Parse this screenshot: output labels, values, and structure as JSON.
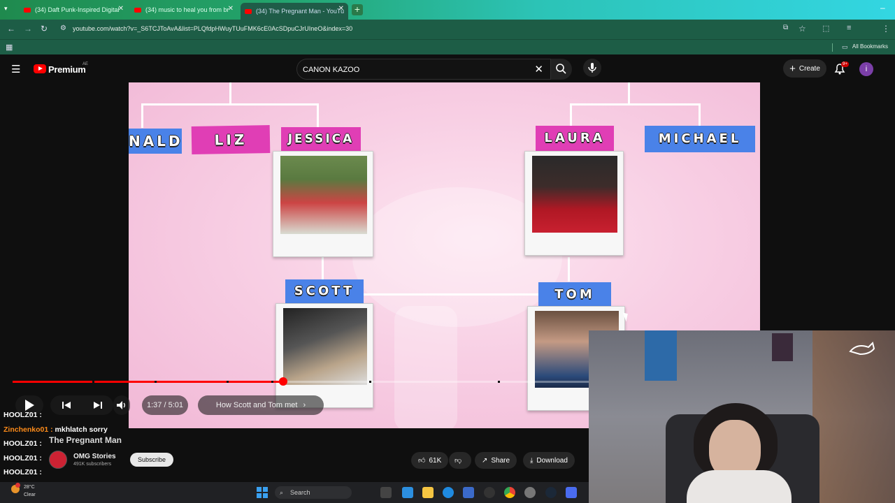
{
  "browser": {
    "tabs": [
      {
        "title": "(34) Daft Punk-Inspired Digital",
        "active": false
      },
      {
        "title": "(34) music to heal you from br",
        "active": false
      },
      {
        "title": "(34) The Pregnant Man - YouTu",
        "active": true
      }
    ],
    "url": "youtube.com/watch?v=_S6TCJToAvA&list=PLQfdpHWuyTUuFMK6cE0AcSDpuCJrUIneO&index=30",
    "bookmarks_label": "All Bookmarks"
  },
  "youtube": {
    "brand": "Premium",
    "country_code": "AE",
    "search_value": "CANON KAZOO",
    "create_label": "Create",
    "notif_badge": "9+",
    "avatar_letter": "i"
  },
  "video_frame": {
    "names": {
      "n1": "NALD",
      "n2": "LIZ",
      "n3": "JESSICA",
      "n4": "LAURA",
      "n5": "MICHAEL",
      "n6": "SCOTT",
      "n7": "TOM"
    }
  },
  "player": {
    "progress": 0.47,
    "time": "1:37 / 5:01",
    "chapter": "How Scott and Tom met"
  },
  "chat": [
    {
      "user": "HOOLZ01 :",
      "msg": "",
      "orange": false
    },
    {
      "user": "Zinchenko01 :",
      "msg": "mkhlatch sorry",
      "orange": true
    },
    {
      "user": "HOOLZ01 :",
      "msg": "",
      "orange": false
    },
    {
      "user": "HOOLZ01 :",
      "msg": "",
      "orange": false
    },
    {
      "user": "HOOLZ01 :",
      "msg": "",
      "orange": false
    }
  ],
  "video_info": {
    "title": "The Pregnant Man",
    "channel": "OMG Stories",
    "subscribers": "491K subscribers",
    "subscribe_label": "Subscribe",
    "likes": "61K",
    "share_label": "Share",
    "download_label": "Download"
  },
  "taskbar": {
    "temp": "28°C",
    "weather": "Clear",
    "search_label": "Search"
  },
  "colors": {
    "accent": "#ff0000",
    "tab_gradient_start": "#1f8a4e",
    "tab_gradient_end": "#33d6e2",
    "video_bg": "#f8cfe4"
  }
}
